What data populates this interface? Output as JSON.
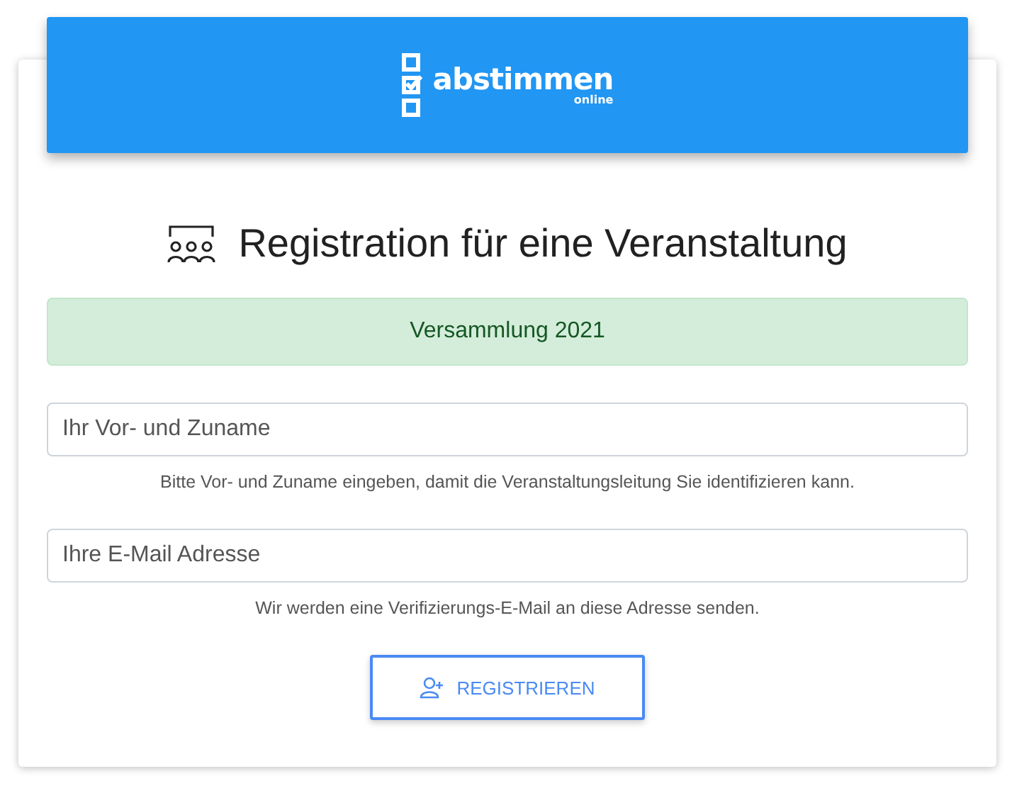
{
  "logo": {
    "name": "abstimmen",
    "tagline": "online"
  },
  "title": "Registration für eine Veranstaltung",
  "event_banner": "Versammlung 2021",
  "fields": [
    {
      "placeholder": "Ihr Vor- und Zuname",
      "help": "Bitte Vor- und Zuname eingeben, damit die Veranstaltungsleitung Sie identifizieren kann."
    },
    {
      "placeholder": "Ihre E-Mail Adresse",
      "help": "Wir werden eine Verifizierungs-E-Mail an diese Adresse senden."
    }
  ],
  "submit_button": "REGISTRIEREN"
}
